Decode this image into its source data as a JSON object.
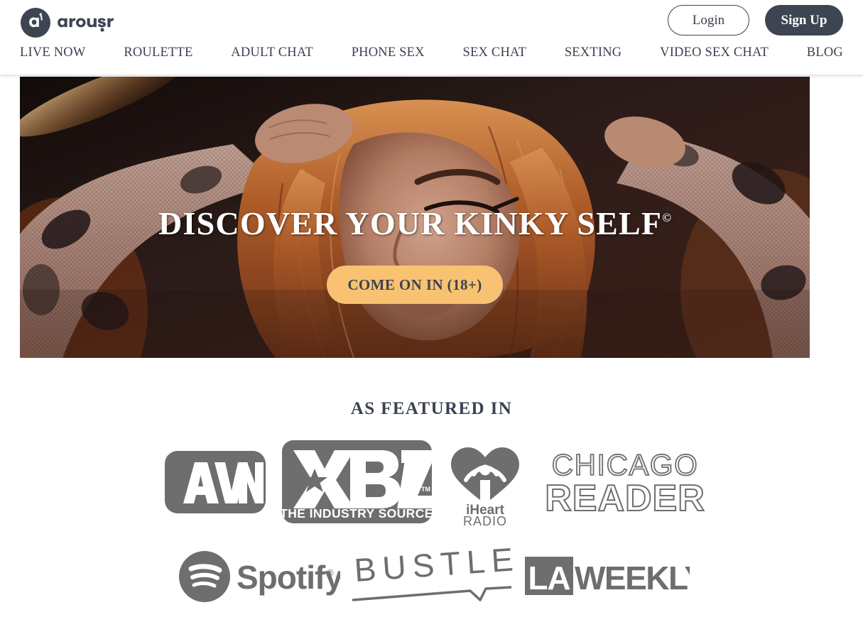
{
  "brand": {
    "name": "arousr",
    "logo_icon": "arousr-circle-mark"
  },
  "header": {
    "login_label": "Login",
    "signup_label": "Sign Up",
    "nav": [
      {
        "label": "LIVE NOW"
      },
      {
        "label": "ROULETTE"
      },
      {
        "label": "ADULT CHAT"
      },
      {
        "label": "PHONE SEX"
      },
      {
        "label": "SEX CHAT"
      },
      {
        "label": "SEXTING"
      },
      {
        "label": "VIDEO SEX CHAT"
      },
      {
        "label": "BLOG"
      }
    ]
  },
  "hero": {
    "title": "DISCOVER YOUR KINKY SELF",
    "title_superscript": "©",
    "cta_label": "COME ON IN (18+)",
    "image_alt": "woman with arms raised above head in mesh top, warm orange toned photo"
  },
  "featured": {
    "title": "AS FEATURED IN",
    "logos_row1": [
      {
        "name": "AVN",
        "icon": "avn-logo"
      },
      {
        "name": "XBIZ",
        "tagline": "THE INDUSTRY SOURCE",
        "icon": "xbiz-logo"
      },
      {
        "name": "iHeartRADIO",
        "line1": "iHeart",
        "line2": "RADIO",
        "icon": "iheartradio-logo"
      },
      {
        "name": "CHICAGO READER",
        "line1": "CHICAGO",
        "line2": "READER",
        "icon": "chicago-reader-logo"
      }
    ],
    "logos_row2": [
      {
        "name": "Spotify",
        "icon": "spotify-logo"
      },
      {
        "name": "BUSTLE",
        "icon": "bustle-logo"
      },
      {
        "name": "LA WEEKLY",
        "line1": "LA",
        "line2": "WEEKLY",
        "icon": "la-weekly-logo"
      }
    ]
  },
  "colors": {
    "dark": "#3e4552",
    "cta_amber": "#f8c272",
    "logo_grey": "#6e6e6e"
  }
}
